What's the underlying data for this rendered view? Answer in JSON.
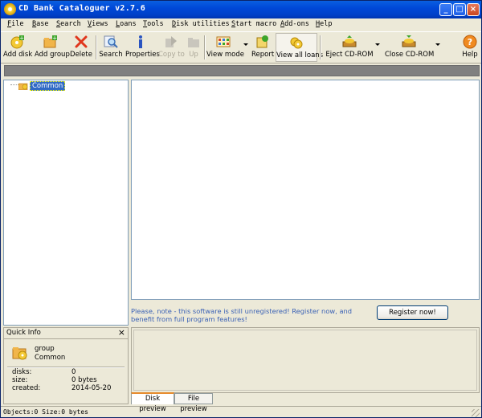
{
  "window": {
    "title": "CD Bank Cataloguer v2.7.6"
  },
  "menu": [
    "File",
    "Base",
    "Search",
    "Views",
    "Loans",
    "Tools",
    "Disk utilities",
    "Start macro",
    "Add-ons",
    "Help"
  ],
  "toolbar": {
    "add_disk": "Add disk",
    "add_group": "Add group",
    "delete": "Delete",
    "search": "Search",
    "properties": "Properties",
    "copy_to": "Copy to",
    "up": "Up",
    "view_mode": "View mode",
    "report": "Report",
    "view_all_loans": "View all loans",
    "eject_cdrom": "Eject CD-ROM",
    "close_cdrom": "Close CD-ROM",
    "help": "Help"
  },
  "tree": {
    "root_label": "Common"
  },
  "notice": {
    "text": "Please, note - this software is still unregistered! Register now, and benefit from full program features!",
    "register_button": "Register now!"
  },
  "quick_info": {
    "title": "Quick Info",
    "close": "×",
    "type": "group",
    "name": "Common",
    "rows": [
      {
        "key": "disks:",
        "value": "0"
      },
      {
        "key": "size:",
        "value": "0 bytes"
      },
      {
        "key": "created:",
        "value": "2014-05-20"
      }
    ]
  },
  "preview_tabs": [
    "Disk preview",
    "File preview"
  ],
  "status": {
    "text": "Objects:0  Size:0 bytes"
  },
  "colors": {
    "titlebar": "#0048d8",
    "selection": "#316ac5",
    "notice": "#3a61b5"
  }
}
